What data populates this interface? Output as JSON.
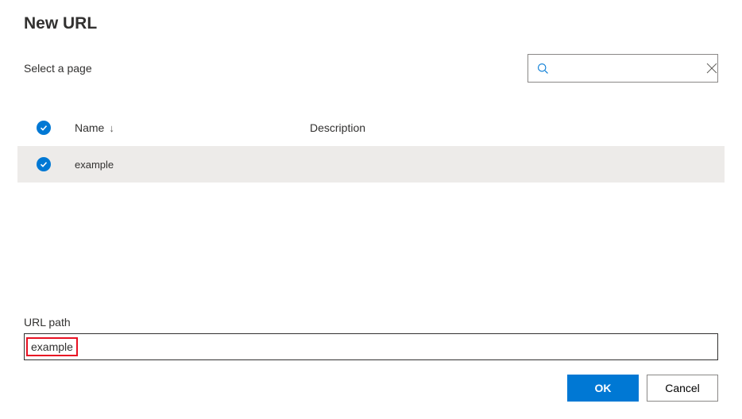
{
  "dialog": {
    "title": "New URL",
    "select_label": "Select a page"
  },
  "search": {
    "placeholder": "",
    "value": ""
  },
  "table": {
    "columns": {
      "name": "Name",
      "description": "Description"
    },
    "rows": [
      {
        "checked": true,
        "name": "example",
        "description": ""
      }
    ]
  },
  "url_path": {
    "label": "URL path",
    "value": "example"
  },
  "footer": {
    "ok_label": "OK",
    "cancel_label": "Cancel"
  },
  "colors": {
    "primary": "#0078D4",
    "error_border": "#E81123",
    "row_bg": "#EDEBE9"
  }
}
